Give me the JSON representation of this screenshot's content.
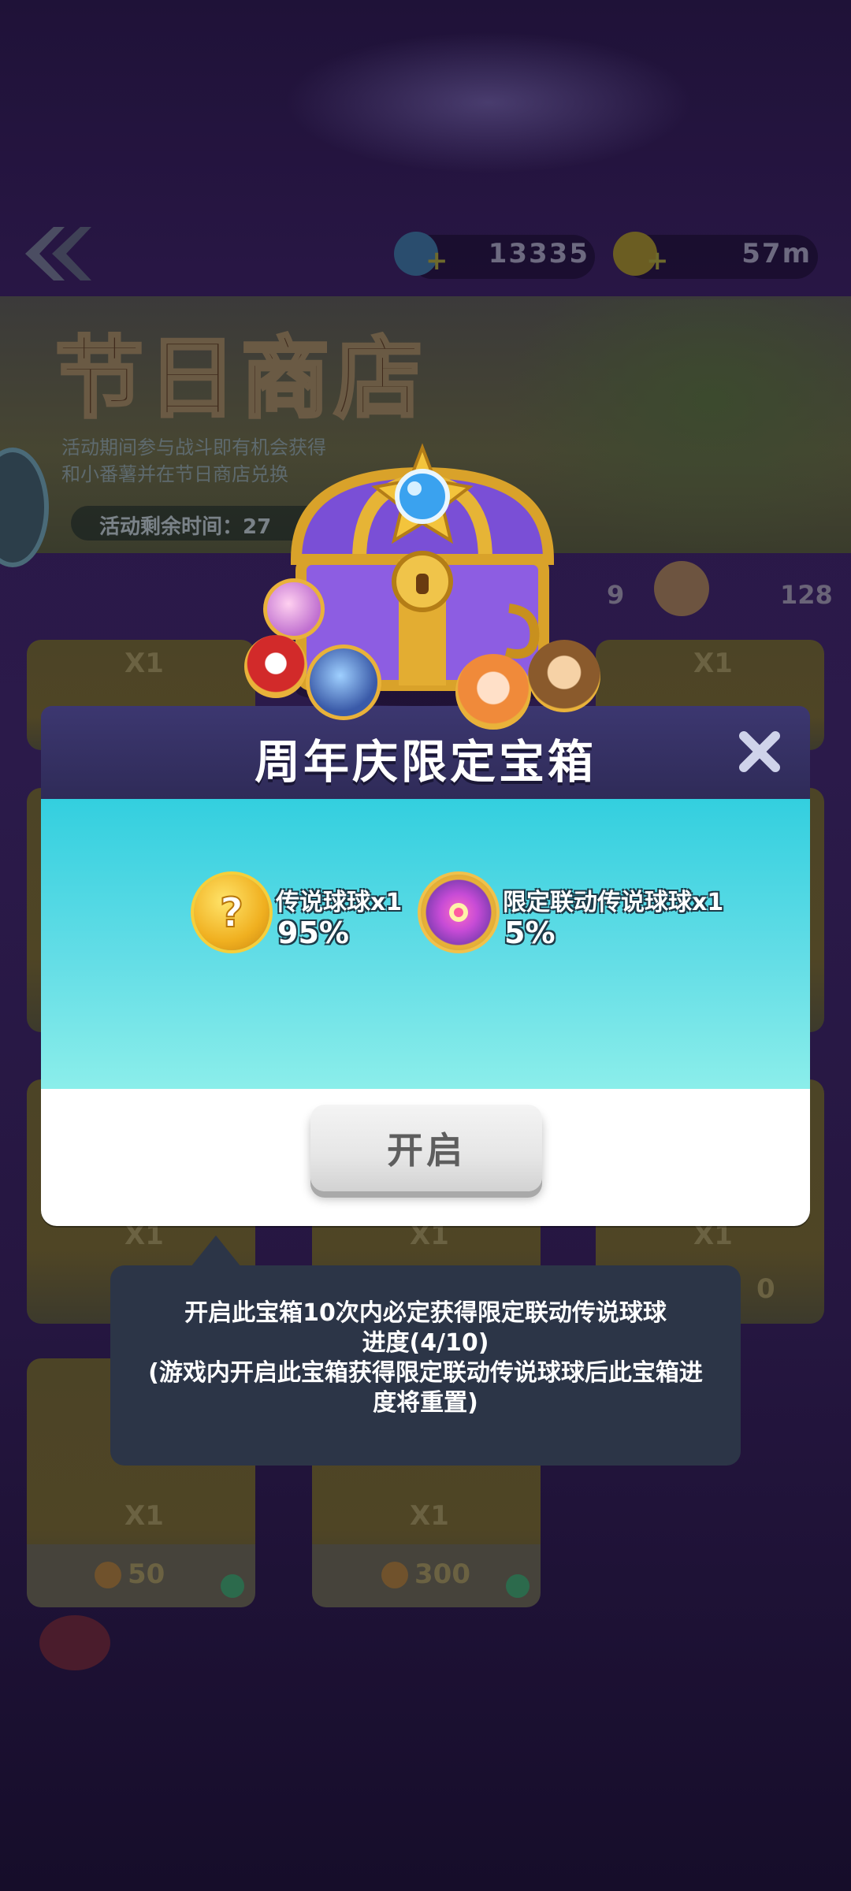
{
  "top_bar": {
    "gems": "13335",
    "coins": "57m"
  },
  "banner": {
    "title": "节日商店",
    "desc_line1": "活动期间参与战斗即有机会获得",
    "desc_line2": "和小番薯并在节日商店兑换",
    "timer": "活动剩余时间：27"
  },
  "stats": {
    "left_count": "9",
    "right_count": "128"
  },
  "shop_cards": {
    "qty_label": "X1",
    "price_1": "50",
    "price_2": "300",
    "price_partial": "0"
  },
  "modal": {
    "title": "周年庆限定宝箱",
    "rewards": [
      {
        "name": "传说球球x1",
        "chance": "95%"
      },
      {
        "name": "限定联动传说球球x1",
        "chance": "5%"
      }
    ],
    "open_button": "开启"
  },
  "tooltip": {
    "line1": "开启此宝箱10次内必定获得限定联动传说球球",
    "line2": "进度(4/10)",
    "line3": "(游戏内开启此宝箱获得限定联动传说球球后此宝箱进",
    "line4": "度将重置)"
  }
}
